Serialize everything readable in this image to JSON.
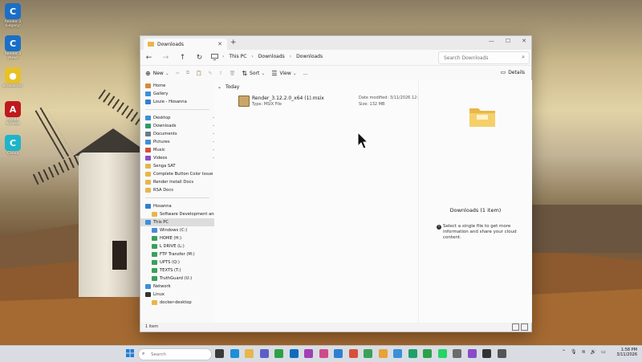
{
  "desktop": {
    "icons": [
      {
        "label": "Render 3 (Legacy)",
        "icon": "render-icon",
        "color": "#1a6fc9"
      },
      {
        "label": "Render 3 (New)",
        "icon": "render-icon",
        "color": "#1a6fc9"
      },
      {
        "label": "arcwatcher",
        "icon": "arcwatcher-icon",
        "color": "#e8c126"
      },
      {
        "label": "Adobe Acrobat",
        "icon": "acrobat-icon",
        "color": "#c0191d"
      },
      {
        "label": "Canva",
        "icon": "canva-icon",
        "color": "#1fb4c9"
      }
    ]
  },
  "window": {
    "tab_title": "Downloads",
    "new_tab": "+",
    "breadcrumbs": [
      "This PC",
      "Downloads",
      "Downloads"
    ],
    "search_placeholder": "Search Downloads",
    "toolbar": {
      "new_label": "New",
      "sort_label": "Sort",
      "view_label": "View",
      "more_label": "...",
      "details_label": "Details"
    },
    "sidebar": {
      "items": [
        {
          "label": "Home",
          "icon": "home-icon",
          "color": "#d88a3a",
          "pinned": false
        },
        {
          "label": "Gallery",
          "icon": "gallery-icon",
          "color": "#3d8fd8",
          "pinned": false
        },
        {
          "label": "Louie - Hosanna",
          "icon": "cloud-icon",
          "color": "#2f7fd0",
          "pinned": false
        },
        {
          "label": "Desktop",
          "icon": "desktop-icon",
          "color": "#3c8fd8",
          "pinned": true
        },
        {
          "label": "Downloads",
          "icon": "downloads-icon",
          "color": "#2f9a6a",
          "pinned": true
        },
        {
          "label": "Documents",
          "icon": "documents-icon",
          "color": "#6b7a8a",
          "pinned": true
        },
        {
          "label": "Pictures",
          "icon": "pictures-icon",
          "color": "#3c8fd8",
          "pinned": true
        },
        {
          "label": "Music",
          "icon": "music-icon",
          "color": "#d8503c",
          "pinned": true
        },
        {
          "label": "Videos",
          "icon": "videos-icon",
          "color": "#8a4cc8",
          "pinned": true
        },
        {
          "label": "Senga SAT",
          "icon": "folder-icon",
          "color": "#e8b64a",
          "pinned": false
        },
        {
          "label": "Complete Button Color Issue",
          "icon": "folder-icon",
          "color": "#e8b64a",
          "pinned": false
        },
        {
          "label": "Render Install Docs",
          "icon": "folder-icon",
          "color": "#e8b64a",
          "pinned": false
        },
        {
          "label": "RSA Docs",
          "icon": "folder-icon",
          "color": "#e8b64a",
          "pinned": false
        },
        {
          "label": "Hosanna",
          "icon": "cloud-icon",
          "color": "#2f7fd0",
          "pinned": false
        },
        {
          "label": "Software Development and Sup",
          "icon": "folder-icon",
          "color": "#e8b64a",
          "pinned": false
        },
        {
          "label": "This PC",
          "icon": "pc-icon",
          "color": "#3c8fd8",
          "pinned": false
        },
        {
          "label": "Windows (C:)",
          "icon": "drive-icon",
          "color": "#4a8ad8",
          "pinned": false
        },
        {
          "label": "HOME (H:)",
          "icon": "drive-icon",
          "color": "#3aa05a",
          "pinned": false
        },
        {
          "label": "L DRIVE (L:)",
          "icon": "drive-icon",
          "color": "#3aa05a",
          "pinned": false
        },
        {
          "label": "FTP Transfer (M:)",
          "icon": "drive-icon",
          "color": "#3aa05a",
          "pinned": false
        },
        {
          "label": "UPTS (Q:)",
          "icon": "drive-icon",
          "color": "#3aa05a",
          "pinned": false
        },
        {
          "label": "TEXTS (T:)",
          "icon": "drive-icon",
          "color": "#3aa05a",
          "pinned": false
        },
        {
          "label": "TruthGuard (U:)",
          "icon": "drive-icon",
          "color": "#3aa05a",
          "pinned": false
        },
        {
          "label": "Network",
          "icon": "network-icon",
          "color": "#3c8fd8",
          "pinned": false
        },
        {
          "label": "Linux",
          "icon": "linux-icon",
          "color": "#333333",
          "pinned": false
        },
        {
          "label": "docker-desktop",
          "icon": "folder-icon",
          "color": "#e8b64a",
          "pinned": false
        }
      ]
    },
    "content": {
      "group_label": "Today",
      "files": [
        {
          "name": "Render_3.12.2.0_x64 (1).msix",
          "type": "Type: MSIX File",
          "date_modified": "Date modified: 3/11/2026 12:56 PM",
          "size": "Size: 132 MB"
        }
      ]
    },
    "details_pane": {
      "title": "Downloads (1 item)",
      "info": "Select a single file to get more information and share your cloud content."
    },
    "status": "1 item"
  },
  "taskbar": {
    "search_placeholder": "Search",
    "apps": [
      {
        "icon": "task-view-icon",
        "color": "#3a3a3a"
      },
      {
        "icon": "edge-icon",
        "color": "#1b8fd8"
      },
      {
        "icon": "file-explorer-icon",
        "color": "#e8b64a"
      },
      {
        "icon": "teams-icon",
        "color": "#5b5fc7"
      },
      {
        "icon": "chrome-icon",
        "color": "#2fa04a"
      },
      {
        "icon": "outlook-icon",
        "color": "#0f6cbd"
      },
      {
        "icon": "app-icon",
        "color": "#a23fb5"
      },
      {
        "icon": "app-icon",
        "color": "#d04b8a"
      },
      {
        "icon": "app-icon",
        "color": "#2f7fd0"
      },
      {
        "icon": "app-icon",
        "color": "#d8503c"
      },
      {
        "icon": "app-icon",
        "color": "#3aa05a"
      },
      {
        "icon": "app-icon",
        "color": "#e8a23a"
      },
      {
        "icon": "app-icon",
        "color": "#3c8fd8"
      },
      {
        "icon": "app-icon",
        "color": "#1fa06a"
      },
      {
        "icon": "app-icon",
        "color": "#2fa04a"
      },
      {
        "icon": "whatsapp-icon",
        "color": "#25d366"
      },
      {
        "icon": "settings-icon",
        "color": "#6b6b6b"
      },
      {
        "icon": "app-icon",
        "color": "#8a4cc8"
      },
      {
        "icon": "app-icon",
        "color": "#333333"
      },
      {
        "icon": "app-icon",
        "color": "#555555"
      }
    ],
    "clock_time": "1:58 PM",
    "clock_date": "3/11/2026"
  }
}
